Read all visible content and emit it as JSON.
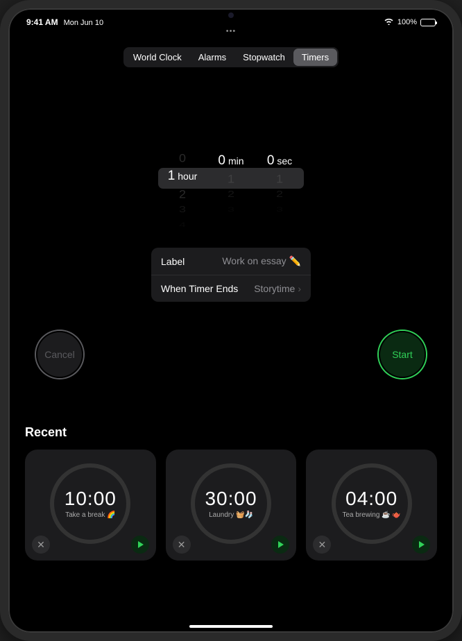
{
  "status": {
    "time": "9:41 AM",
    "date": "Mon Jun 10",
    "battery": "100%"
  },
  "tabs": {
    "world_clock": "World Clock",
    "alarms": "Alarms",
    "stopwatch": "Stopwatch",
    "timers": "Timers"
  },
  "picker": {
    "hour": {
      "above": [
        "0"
      ],
      "sel": "1",
      "unit": "hour",
      "below": [
        "2",
        "3",
        "4"
      ]
    },
    "min": {
      "above": [
        ""
      ],
      "sel": "0",
      "unit": "min",
      "below": [
        "1",
        "2",
        "3"
      ]
    },
    "sec": {
      "above": [
        ""
      ],
      "sel": "0",
      "unit": "sec",
      "below": [
        "1",
        "2",
        "3"
      ]
    }
  },
  "settings": {
    "label_key": "Label",
    "label_val": "Work on essay ✏️",
    "end_key": "When Timer Ends",
    "end_val": "Storytime"
  },
  "buttons": {
    "cancel": "Cancel",
    "start": "Start"
  },
  "recent": {
    "title": "Recent",
    "items": [
      {
        "time": "10:00",
        "label": "Take a break 🌈"
      },
      {
        "time": "30:00",
        "label": "Laundry 🧺🧦"
      },
      {
        "time": "04:00",
        "label": "Tea brewing ☕️ 🫖"
      }
    ]
  }
}
